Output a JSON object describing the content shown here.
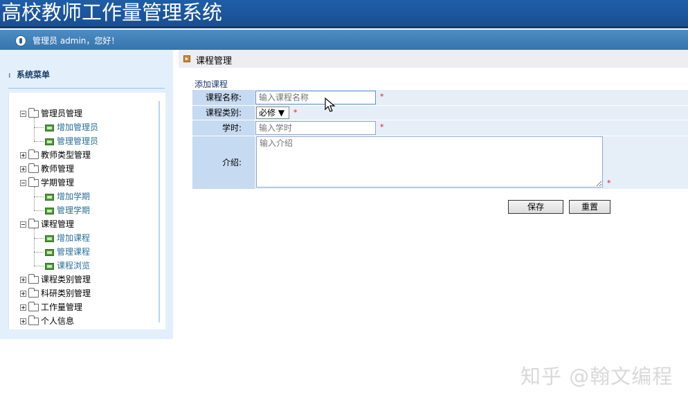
{
  "header": {
    "title": "高校教师工作量管理系统"
  },
  "userbar": {
    "greeting": "管理员 admin，您好！",
    "icon": "user-icon"
  },
  "sidebar": {
    "heading": "系统菜单",
    "tree": [
      {
        "label": "管理员管理",
        "expanded": true,
        "children": [
          "增加管理员",
          "管理管理员"
        ]
      },
      {
        "label": "教师类型管理",
        "expanded": false,
        "children": []
      },
      {
        "label": "教师管理",
        "expanded": false,
        "children": []
      },
      {
        "label": "学期管理",
        "expanded": true,
        "children": [
          "增加学期",
          "管理学期"
        ]
      },
      {
        "label": "课程管理",
        "expanded": true,
        "children": [
          "增加课程",
          "管理课程",
          "课程浏览"
        ]
      },
      {
        "label": "课程类别管理",
        "expanded": false,
        "children": []
      },
      {
        "label": "科研类别管理",
        "expanded": false,
        "children": []
      },
      {
        "label": "工作量管理",
        "expanded": false,
        "children": []
      },
      {
        "label": "个人信息",
        "expanded": false,
        "children": []
      }
    ]
  },
  "main": {
    "breadcrumb": "课程管理",
    "form_title": "添加课程",
    "fields": {
      "name": {
        "label": "课程名称:",
        "placeholder": "输入课程名称",
        "value": ""
      },
      "category": {
        "label": "课程类别:",
        "selected": "必修 ▼"
      },
      "hours": {
        "label": "学时:",
        "placeholder": "输入学时",
        "value": ""
      },
      "intro": {
        "label": "介绍:",
        "placeholder": "输入介绍",
        "value": ""
      }
    },
    "required_mark": "*",
    "buttons": {
      "save": "保存",
      "reset": "重置"
    }
  },
  "watermark": "知乎 @翰文编程"
}
